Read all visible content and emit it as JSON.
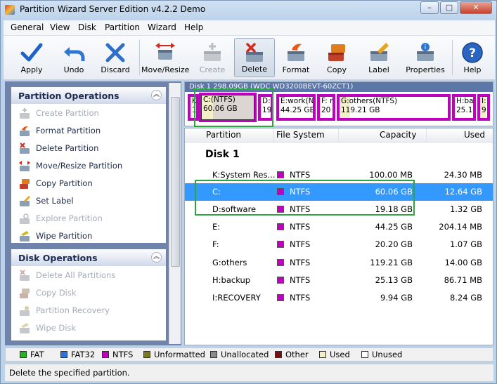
{
  "window": {
    "title": "Partition Wizard Server Edition v4.2.2 Demo",
    "controls": [
      "–",
      "□",
      "✕"
    ]
  },
  "menu": [
    "General",
    "View",
    "Disk",
    "Partition",
    "Wizard",
    "Help"
  ],
  "toolbar": [
    {
      "label": "Apply",
      "icon": "checkmark-icon",
      "enabled": true
    },
    {
      "label": "Undo",
      "icon": "undo-icon",
      "enabled": true
    },
    {
      "label": "Discard",
      "icon": "discard-icon",
      "enabled": true
    },
    {
      "label": "Move/Resize",
      "icon": "move-resize-icon",
      "enabled": true
    },
    {
      "label": "Create",
      "icon": "create-partition-icon",
      "enabled": false
    },
    {
      "label": "Delete",
      "icon": "delete-partition-icon",
      "enabled": true,
      "active": true
    },
    {
      "label": "Format",
      "icon": "format-icon",
      "enabled": true
    },
    {
      "label": "Copy",
      "icon": "copy-icon",
      "enabled": true
    },
    {
      "label": "Label",
      "icon": "label-icon",
      "enabled": true
    },
    {
      "label": "Properties",
      "icon": "properties-icon",
      "enabled": true
    },
    {
      "label": "Help",
      "icon": "help-icon",
      "enabled": true
    }
  ],
  "partition_operations": {
    "title": "Partition Operations",
    "items": [
      {
        "label": "Create Partition",
        "enabled": false
      },
      {
        "label": "Format Partition",
        "enabled": true
      },
      {
        "label": "Delete Partition",
        "enabled": true
      },
      {
        "label": "Move/Resize Partition",
        "enabled": true
      },
      {
        "label": "Copy Partition",
        "enabled": true
      },
      {
        "label": "Set Label",
        "enabled": true
      },
      {
        "label": "Explore Partition",
        "enabled": false
      },
      {
        "label": "Wipe Partition",
        "enabled": true
      }
    ]
  },
  "disk_operations": {
    "title": "Disk Operations",
    "items": [
      {
        "label": "Delete All Partitions",
        "enabled": false
      },
      {
        "label": "Copy Disk",
        "enabled": false
      },
      {
        "label": "Partition Recovery",
        "enabled": false
      },
      {
        "label": "Wipe Disk",
        "enabled": false
      }
    ]
  },
  "diskmap": {
    "header": "Disk 1 298.09GB   (WDC WD3200BEVT-60ZCT1)",
    "blocks": [
      {
        "line1": "K:",
        "line2": "1"
      },
      {
        "line1": "C:(NTFS)",
        "line2": "60.06 GB",
        "selected": true
      },
      {
        "line1": "D:",
        "line2": "19"
      },
      {
        "line1": "E:work(NT",
        "line2": "44.25 GB"
      },
      {
        "line1": "F: n",
        "line2": "20"
      },
      {
        "line1": "G:others(NTFS)",
        "line2": "119.21 GB"
      },
      {
        "line1": "H:ba",
        "line2": "25.1"
      },
      {
        "line1": "I:",
        "line2": "9"
      }
    ]
  },
  "list": {
    "columns": [
      "Partition",
      "File System",
      "Capacity",
      "Used"
    ],
    "disk_title": "Disk 1",
    "rows": [
      {
        "partition": "K:System Res...",
        "fs": "NTFS",
        "capacity": "100.00 MB",
        "used": "24.30 MB"
      },
      {
        "partition": "C:",
        "fs": "NTFS",
        "capacity": "60.06 GB",
        "used": "12.64 GB",
        "selected": true
      },
      {
        "partition": "D:software",
        "fs": "NTFS",
        "capacity": "19.18 GB",
        "used": "1.32 GB"
      },
      {
        "partition": "E:",
        "fs": "NTFS",
        "capacity": "44.25 GB",
        "used": "204.14 MB"
      },
      {
        "partition": "F:",
        "fs": "NTFS",
        "capacity": "20.20 GB",
        "used": "1.07 GB"
      },
      {
        "partition": "G:others",
        "fs": "NTFS",
        "capacity": "119.21 GB",
        "used": "14.00 GB"
      },
      {
        "partition": "H:backup",
        "fs": "NTFS",
        "capacity": "25.13 GB",
        "used": "86.71 MB"
      },
      {
        "partition": "I:RECOVERY",
        "fs": "NTFS",
        "capacity": "9.94 GB",
        "used": "8.24 GB"
      }
    ]
  },
  "legend": [
    {
      "label": "FAT",
      "color": "#22b422"
    },
    {
      "label": "FAT32",
      "color": "#2f6fe0"
    },
    {
      "label": "NTFS",
      "color": "#c000c0"
    },
    {
      "label": "Unformatted",
      "color": "#7a7a1a"
    },
    {
      "label": "Unallocated",
      "color": "#8a8a8a"
    },
    {
      "label": "Other",
      "color": "#7a0f0f"
    },
    {
      "label": "Used",
      "color": "#f3f0c7"
    },
    {
      "label": "Unused",
      "color": "#ffffff"
    }
  ],
  "status": "Delete the specified partition.",
  "colors": {
    "ntfs": "#c000c0",
    "selection": "#3399ff",
    "highlight": "#2aa63c"
  }
}
